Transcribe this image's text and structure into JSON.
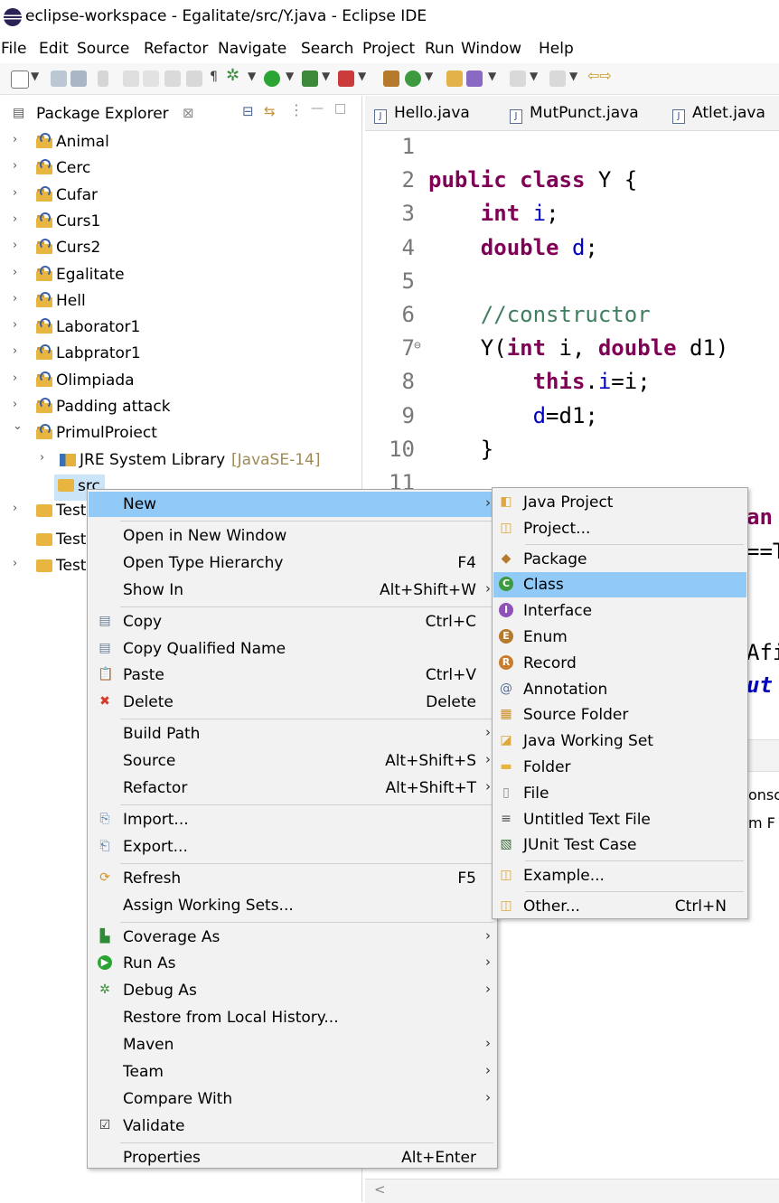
{
  "window": {
    "title": "eclipse-workspace - Egalitate/src/Y.java - Eclipse IDE"
  },
  "menubar": [
    "File",
    "Edit",
    "Source",
    "Refactor",
    "Navigate",
    "Search",
    "Project",
    "Run",
    "Window",
    "Help"
  ],
  "package_explorer": {
    "title": "Package Explorer",
    "close_glyph": "⊠",
    "projects": [
      "Animal",
      "Cerc",
      "Cufar",
      "Curs1",
      "Curs2",
      "Egalitate",
      "Hell",
      "Laborator1",
      "Labprator1",
      "Olimpiada",
      "Padding attack",
      "PrimulProiect"
    ],
    "jre": {
      "label": "JRE System Library",
      "version": "[JavaSE-14]"
    },
    "src_label": "src",
    "test_items": [
      "Test",
      "Test",
      "Test"
    ]
  },
  "editor": {
    "tabs": [
      "Hello.java",
      "MutPunct.java",
      "Atlet.java"
    ],
    "lines": [
      {
        "n": "1",
        "segs": []
      },
      {
        "n": "2",
        "segs": [
          {
            "t": "public class ",
            "c": "kw"
          },
          {
            "t": "Y {",
            "c": ""
          }
        ]
      },
      {
        "n": "3",
        "segs": [
          {
            "t": "    ",
            "c": ""
          },
          {
            "t": "int",
            "c": "kw"
          },
          {
            "t": " ",
            "c": ""
          },
          {
            "t": "i",
            "c": "fld"
          },
          {
            "t": ";",
            "c": ""
          }
        ]
      },
      {
        "n": "4",
        "segs": [
          {
            "t": "    ",
            "c": ""
          },
          {
            "t": "double",
            "c": "kw"
          },
          {
            "t": " ",
            "c": ""
          },
          {
            "t": "d",
            "c": "fld"
          },
          {
            "t": ";",
            "c": ""
          }
        ]
      },
      {
        "n": "5",
        "segs": []
      },
      {
        "n": "6",
        "segs": [
          {
            "t": "    ",
            "c": ""
          },
          {
            "t": "//constructor",
            "c": "cmt"
          }
        ]
      },
      {
        "n": "7",
        "segs": [
          {
            "t": "    Y(",
            "c": ""
          },
          {
            "t": "int",
            "c": "kw"
          },
          {
            "t": " i, ",
            "c": ""
          },
          {
            "t": "double",
            "c": "kw"
          },
          {
            "t": " d1)",
            "c": ""
          }
        ]
      },
      {
        "n": "8",
        "segs": [
          {
            "t": "        ",
            "c": ""
          },
          {
            "t": "this",
            "c": "kw"
          },
          {
            "t": ".",
            "c": ""
          },
          {
            "t": "i",
            "c": "fld"
          },
          {
            "t": "=i;",
            "c": ""
          }
        ]
      },
      {
        "n": "9",
        "segs": [
          {
            "t": "        ",
            "c": ""
          },
          {
            "t": "d",
            "c": "fld"
          },
          {
            "t": "=d1;",
            "c": ""
          }
        ]
      },
      {
        "n": "10",
        "segs": [
          {
            "t": "    }",
            "c": ""
          }
        ]
      },
      {
        "n": "11",
        "segs": []
      }
    ],
    "fold_marker": "⊖",
    "behind_menu_fragments": [
      "an",
      "==T",
      "Afi",
      "ut",
      "onsc",
      "m F"
    ]
  },
  "context_menu": {
    "items": [
      {
        "label": "New",
        "accel": "",
        "arrow": true,
        "icon": "",
        "hl": true
      },
      {
        "sep": true
      },
      {
        "label": "Open in New Window",
        "accel": "",
        "arrow": false,
        "icon": ""
      },
      {
        "label": "Open Type Hierarchy",
        "accel": "F4",
        "arrow": false,
        "icon": ""
      },
      {
        "label": "Show In",
        "accel": "Alt+Shift+W",
        "arrow": true,
        "icon": ""
      },
      {
        "sep": true
      },
      {
        "label": "Copy",
        "accel": "Ctrl+C",
        "arrow": false,
        "icon": "copy-icon"
      },
      {
        "label": "Copy Qualified Name",
        "accel": "",
        "arrow": false,
        "icon": "copy-qualified-icon"
      },
      {
        "label": "Paste",
        "accel": "Ctrl+V",
        "arrow": false,
        "icon": "paste-icon"
      },
      {
        "label": "Delete",
        "accel": "Delete",
        "arrow": false,
        "icon": "delete-icon"
      },
      {
        "sep": true
      },
      {
        "label": "Build Path",
        "accel": "",
        "arrow": true,
        "icon": ""
      },
      {
        "label": "Source",
        "accel": "Alt+Shift+S",
        "arrow": true,
        "icon": ""
      },
      {
        "label": "Refactor",
        "accel": "Alt+Shift+T",
        "arrow": true,
        "icon": ""
      },
      {
        "sep": true
      },
      {
        "label": "Import...",
        "accel": "",
        "arrow": false,
        "icon": "import-icon"
      },
      {
        "label": "Export...",
        "accel": "",
        "arrow": false,
        "icon": "export-icon"
      },
      {
        "sep": true
      },
      {
        "label": "Refresh",
        "accel": "F5",
        "arrow": false,
        "icon": "refresh-icon"
      },
      {
        "label": "Assign Working Sets...",
        "accel": "",
        "arrow": false,
        "icon": ""
      },
      {
        "sep": true
      },
      {
        "label": "Coverage As",
        "accel": "",
        "arrow": true,
        "icon": "coverage-icon"
      },
      {
        "label": "Run As",
        "accel": "",
        "arrow": true,
        "icon": "run-icon"
      },
      {
        "label": "Debug As",
        "accel": "",
        "arrow": true,
        "icon": "debug-icon"
      },
      {
        "label": "Restore from Local History...",
        "accel": "",
        "arrow": false,
        "icon": ""
      },
      {
        "label": "Maven",
        "accel": "",
        "arrow": true,
        "icon": ""
      },
      {
        "label": "Team",
        "accel": "",
        "arrow": true,
        "icon": ""
      },
      {
        "label": "Compare With",
        "accel": "",
        "arrow": true,
        "icon": ""
      },
      {
        "label": "Validate",
        "accel": "",
        "arrow": false,
        "icon": "checkbox-checked-icon"
      },
      {
        "sep": true
      },
      {
        "label": "Properties",
        "accel": "Alt+Enter",
        "arrow": false,
        "icon": ""
      }
    ]
  },
  "new_submenu": {
    "items": [
      {
        "label": "Java Project",
        "accel": "",
        "icon": "java-project-icon"
      },
      {
        "label": "Project...",
        "accel": "",
        "icon": "project-icon"
      },
      {
        "sep": true
      },
      {
        "label": "Package",
        "accel": "",
        "icon": "package-icon"
      },
      {
        "label": "Class",
        "accel": "",
        "icon": "class-icon",
        "hl": true
      },
      {
        "label": "Interface",
        "accel": "",
        "icon": "interface-icon"
      },
      {
        "label": "Enum",
        "accel": "",
        "icon": "enum-icon"
      },
      {
        "label": "Record",
        "accel": "",
        "icon": "record-icon"
      },
      {
        "label": "Annotation",
        "accel": "",
        "icon": "annotation-icon"
      },
      {
        "label": "Source Folder",
        "accel": "",
        "icon": "source-folder-icon"
      },
      {
        "label": "Java Working Set",
        "accel": "",
        "icon": "working-set-icon"
      },
      {
        "label": "Folder",
        "accel": "",
        "icon": "folder-icon"
      },
      {
        "label": "File",
        "accel": "",
        "icon": "file-icon"
      },
      {
        "label": "Untitled Text File",
        "accel": "",
        "icon": "text-file-icon"
      },
      {
        "label": "JUnit Test Case",
        "accel": "",
        "icon": "junit-icon"
      },
      {
        "sep": true
      },
      {
        "label": "Example...",
        "accel": "",
        "icon": "example-icon"
      },
      {
        "sep": true
      },
      {
        "label": "Other...",
        "accel": "Ctrl+N",
        "icon": "other-icon"
      }
    ]
  }
}
